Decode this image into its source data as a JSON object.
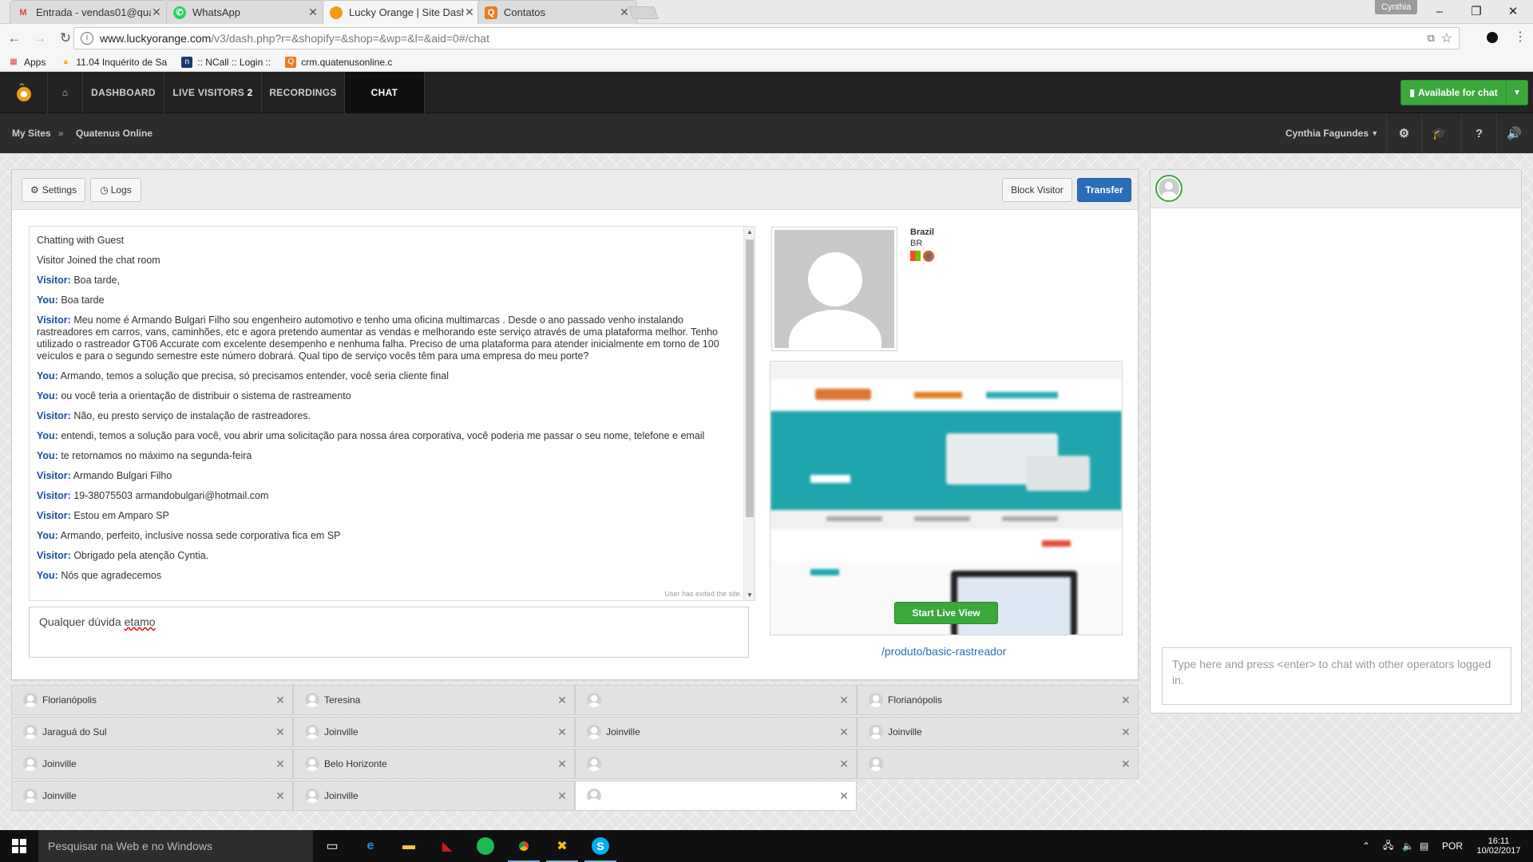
{
  "browser": {
    "tabs": [
      {
        "label": "Entrada - vendas01@qua",
        "favicon": "gmail-icon",
        "color": "#d44638"
      },
      {
        "label": "WhatsApp",
        "favicon": "whatsapp-icon",
        "color": "#25d366"
      },
      {
        "label": "Lucky Orange | Site Dash",
        "favicon": "lucky-orange-icon",
        "color": "#f39c12"
      },
      {
        "label": "Contatos",
        "favicon": "contacts-icon",
        "color": "#e67e22"
      }
    ],
    "profile": "Cynthia",
    "url_host": "www.luckyorange.com",
    "url_path": "/v3/dash.php?r=&shopify=&shop=&wp=&l=&aid=0#/chat",
    "bookmarks": [
      {
        "label": "Apps",
        "icon": "apps-grid-icon"
      },
      {
        "label": "11.04 Inquérito de Sa",
        "icon": "drive-icon"
      },
      {
        "label": ":: NCall :: Login ::",
        "icon": "ncall-icon"
      },
      {
        "label": "crm.quatenusonline.c",
        "icon": "crm-icon"
      }
    ]
  },
  "app": {
    "nav": [
      {
        "label": "DASHBOARD"
      },
      {
        "label": "LIVE VISITORS",
        "badge": "2"
      },
      {
        "label": "RECORDINGS"
      },
      {
        "label": "CHAT"
      }
    ],
    "available_label": "Available for chat",
    "breadcrumb": {
      "root": "My Sites",
      "sep": "»",
      "site": "Quatenus Online"
    },
    "user": "Cynthia Fagundes"
  },
  "toolbar": {
    "settings": "Settings",
    "logs": "Logs",
    "block": "Block Visitor",
    "transfer": "Transfer"
  },
  "chat": {
    "messages": [
      {
        "who": "",
        "text": "Chatting with Guest"
      },
      {
        "who": "",
        "text": "Visitor Joined the chat room"
      },
      {
        "who": "Visitor:",
        "text": " Boa tarde,"
      },
      {
        "who": "You:",
        "text": " Boa tarde"
      },
      {
        "who": "Visitor:",
        "text": " Meu nome é Armando Bulgari Filho sou engenheiro automotivo e tenho uma oficina multimarcas . Desde o ano passado venho instalando rastreadores em carros, vans, caminhões, etc e agora pretendo aumentar as vendas e melhorando este serviço através de uma plataforma melhor. Tenho utilizado o rastreador GT06 Accurate com excelente desempenho e nenhuma falha. Preciso de uma plataforma para atender inicialmente em torno de 100 veículos e para o segundo semestre este número dobrará. Qual tipo de serviço vocês têm para uma empresa do meu porte?"
      },
      {
        "who": "You:",
        "text": " Armando, temos a solução que precisa, só precisamos entender, você seria cliente final"
      },
      {
        "who": "You:",
        "text": " ou você teria a orientação de distribuir o sistema de rastreamento"
      },
      {
        "who": "Visitor:",
        "text": " Não, eu presto serviço de instalação de rastreadores."
      },
      {
        "who": "You:",
        "text": " entendi, temos a solução para você, vou abrir uma solicitação para nossa área corporativa, você poderia me passar o seu nome, telefone e email"
      },
      {
        "who": "You:",
        "text": " te retornamos no máximo na segunda-feira"
      },
      {
        "who": "Visitor:",
        "text": " Armando Bulgari Filho"
      },
      {
        "who": "Visitor:",
        "text": " 19-38075503 armandobulgari@hotmail.com"
      },
      {
        "who": "Visitor:",
        "text": " Estou em Amparo SP"
      },
      {
        "who": "You:",
        "text": " Armando, perfeito, inclusive nossa sede corporativa fica em SP"
      },
      {
        "who": "Visitor:",
        "text": " Obrigado pela atenção Cyntia."
      },
      {
        "who": "You:",
        "text": " Nós que agradecemos"
      }
    ],
    "exited": "User has exited the site.",
    "composer_text": "Qualquer dúvida ",
    "composer_misspelled": "etamo"
  },
  "visitor": {
    "country": "Brazil",
    "code": "BR",
    "page_path": "/produto/basic-rastreador",
    "live_view_label": "Start Live View"
  },
  "operators": {
    "placeholder": "Type here and press <enter> to chat with other operators logged in."
  },
  "tiles": [
    "Florianópolis",
    "Teresina",
    "",
    "Florianópolis",
    "Jaraguá do Sul",
    "Joinville",
    "Joinville",
    "Joinville",
    "Joinville",
    "Belo Horizonte",
    "",
    "",
    "Joinville",
    "Joinville",
    ""
  ],
  "taskbar": {
    "search": "Pesquisar na Web e no Windows",
    "lang": "POR",
    "time": "16:11",
    "date": "10/02/2017"
  }
}
